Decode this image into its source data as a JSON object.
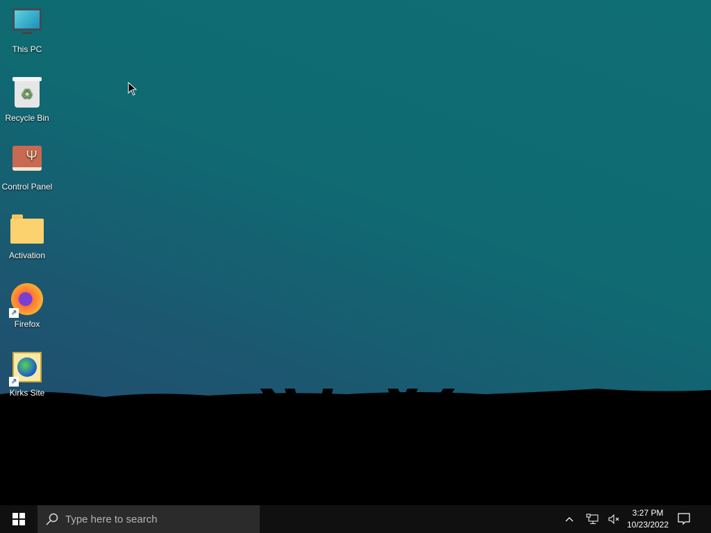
{
  "desktop": {
    "icons": [
      {
        "label": "This PC",
        "icon": "monitor-icon",
        "shortcut": false
      },
      {
        "label": "Recycle Bin",
        "icon": "recycle-bin-icon",
        "shortcut": false
      },
      {
        "label": "Control Panel",
        "icon": "control-panel-icon",
        "shortcut": false
      },
      {
        "label": "Activation",
        "icon": "folder-icon",
        "shortcut": false
      },
      {
        "label": "Firefox",
        "icon": "firefox-icon",
        "shortcut": true
      },
      {
        "label": "Kirks Site",
        "icon": "web-page-icon",
        "shortcut": true
      }
    ]
  },
  "taskbar": {
    "search_placeholder": "Type here to search",
    "time": "3:27 PM",
    "date": "10/23/2022"
  }
}
